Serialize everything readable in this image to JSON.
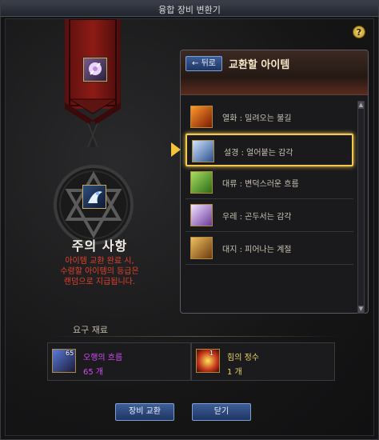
{
  "window": {
    "title": "융합 장비 변환기"
  },
  "help": {
    "label": "?"
  },
  "notice": {
    "title": "주의 사항",
    "lines": [
      "아이템 교환 완료 시,",
      "수령할 아이템의 등급은",
      "랜덤으로 지급됩니다."
    ]
  },
  "panel": {
    "back_label": "뒤로",
    "title": "교환할 아이템",
    "items": [
      {
        "label": "열화 : 밀려오는 불길",
        "icon": "fire-sword-icon",
        "selected": false
      },
      {
        "label": "설경 : 얼어붙는 감각",
        "icon": "frost-spirit-icon",
        "selected": true
      },
      {
        "label": "대류 : 변덕스러운 흐름",
        "icon": "wind-orb-icon",
        "selected": false
      },
      {
        "label": "우레 : 곤두서는 감각",
        "icon": "thunder-icon",
        "selected": false
      },
      {
        "label": "대지 : 피어나는 계절",
        "icon": "earth-icon",
        "selected": false
      }
    ]
  },
  "requirements": {
    "label": "요구 재료",
    "materials": [
      {
        "name": "오행의 흐름",
        "qty": "65 개",
        "badge": "65",
        "name_color": "#d24df2",
        "qty_color": "#d24df2",
        "icon": "five-elements-icon"
      },
      {
        "name": "힘의 정수",
        "qty": "1 개",
        "badge": "1",
        "name_color": "#e9d36a",
        "qty_color": "#e9d36a",
        "icon": "power-essence-icon"
      }
    ]
  },
  "buttons": {
    "exchange": "장비 교환",
    "close": "닫기"
  },
  "colors": {
    "accent_gold": "#f2c94c",
    "warning_red": "#e0402a",
    "button_blue": "#2d4a80"
  }
}
